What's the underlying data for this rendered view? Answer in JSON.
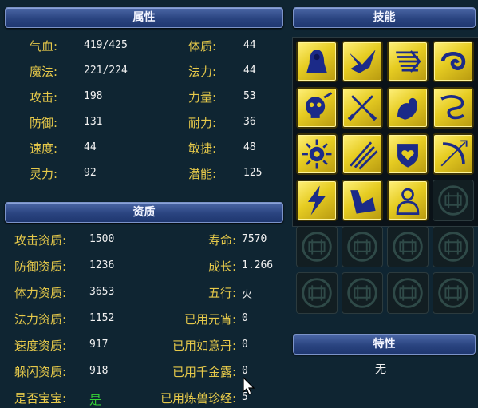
{
  "attributes": {
    "title": "属性",
    "rows": [
      {
        "label": "气血:",
        "value": "419/425",
        "label2": "体质:",
        "value2": "44"
      },
      {
        "label": "魔法:",
        "value": "221/224",
        "label2": "法力:",
        "value2": "44"
      },
      {
        "label": "攻击:",
        "value": "198",
        "label2": "力量:",
        "value2": "53"
      },
      {
        "label": "防御:",
        "value": "131",
        "label2": "耐力:",
        "value2": "36"
      },
      {
        "label": "速度:",
        "value": "44",
        "label2": "敏捷:",
        "value2": "48"
      },
      {
        "label": "灵力:",
        "value": "92",
        "label2": "潜能:",
        "value2": "125"
      }
    ]
  },
  "aptitude": {
    "title": "资质",
    "rows": [
      {
        "label": "攻击资质:",
        "value": "1500",
        "label2": "寿命:",
        "value2": "7570"
      },
      {
        "label": "防御资质:",
        "value": "1236",
        "label2": "成长:",
        "value2": "1.266"
      },
      {
        "label": "体力资质:",
        "value": "3653",
        "label2": "五行:",
        "value2": "火"
      },
      {
        "label": "法力资质:",
        "value": "1152",
        "label2": "已用元宵:",
        "value2": "0"
      },
      {
        "label": "速度资质:",
        "value": "917",
        "label2": "已用如意丹:",
        "value2": "0"
      },
      {
        "label": "躲闪资质:",
        "value": "918",
        "label2": "已用千金露:",
        "value2": "0"
      },
      {
        "label": "是否宝宝:",
        "value": "是",
        "label2": "已用炼兽珍经:",
        "value2": "5"
      }
    ]
  },
  "skills": {
    "title": "技能",
    "icons": [
      "hooded-figure-icon",
      "eagle-icon",
      "speed-lines-icon",
      "serpent-icon",
      "skull-icon",
      "crossed-swords-icon",
      "flexing-arm-icon",
      "dragon-icon",
      "sun-emblem-icon",
      "claw-slash-icon",
      "heart-shield-icon",
      "bow-arrow-icon",
      "lightning-icon",
      "strong-arm-icon",
      "meditating-monk-icon"
    ],
    "empty_slots": 9
  },
  "traits": {
    "title": "特性",
    "value": "无"
  },
  "colors": {
    "label": "#e6c94a",
    "value": "#f2f2f2",
    "yes": "#36d436",
    "panel_bar": "#2a4480",
    "skill_gold": "#e6cc22"
  }
}
